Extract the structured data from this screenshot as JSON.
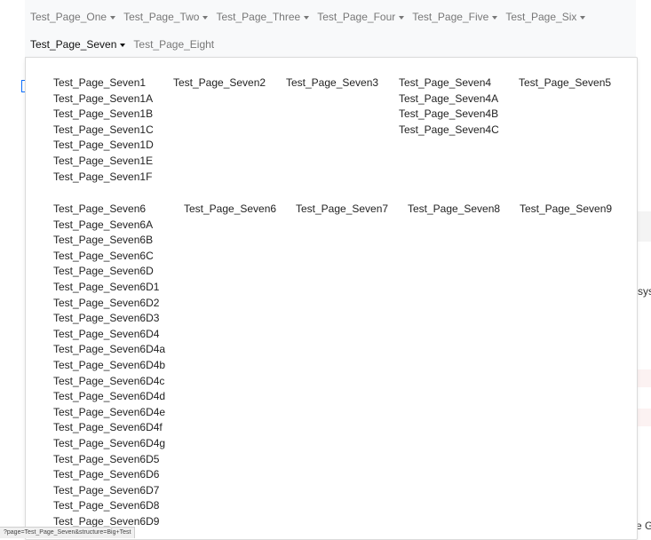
{
  "navbar": {
    "row1": [
      {
        "label": "Test_Page_One"
      },
      {
        "label": "Test_Page_Two"
      },
      {
        "label": "Test_Page_Three"
      },
      {
        "label": "Test_Page_Four"
      },
      {
        "label": "Test_Page_Five"
      },
      {
        "label": "Test_Page_Six"
      }
    ],
    "row2": [
      {
        "label": "Test_Page_Seven",
        "active": true
      },
      {
        "label": "Test_Page_Eight"
      }
    ]
  },
  "dropdown": {
    "group1": {
      "col1": [
        "Test_Page_Seven1",
        "Test_Page_Seven1A",
        "Test_Page_Seven1B",
        "Test_Page_Seven1C",
        "Test_Page_Seven1D",
        "Test_Page_Seven1E",
        "Test_Page_Seven1F"
      ],
      "col2": [
        "Test_Page_Seven2"
      ],
      "col3": [
        "Test_Page_Seven3"
      ],
      "col4": [
        "Test_Page_Seven4",
        "Test_Page_Seven4A",
        "Test_Page_Seven4B",
        "Test_Page_Seven4C"
      ],
      "col5": [
        "Test_Page_Seven5"
      ]
    },
    "group2": {
      "col1": [
        "Test_Page_Seven6",
        "Test_Page_Seven6A",
        "Test_Page_Seven6B",
        "Test_Page_Seven6C",
        "Test_Page_Seven6D",
        "Test_Page_Seven6D1",
        "Test_Page_Seven6D2",
        "Test_Page_Seven6D3",
        "Test_Page_Seven6D4",
        "Test_Page_Seven6D4a",
        "Test_Page_Seven6D4b",
        "Test_Page_Seven6D4c",
        "Test_Page_Seven6D4d",
        "Test_Page_Seven6D4e",
        "Test_Page_Seven6D4f",
        "Test_Page_Seven6D4g",
        "Test_Page_Seven6D5",
        "Test_Page_Seven6D6",
        "Test_Page_Seven6D7",
        "Test_Page_Seven6D8",
        "Test_Page_Seven6D9"
      ],
      "col2": [
        "Test_Page_Seven6"
      ],
      "col3": [
        "Test_Page_Seven7"
      ],
      "col4": [
        "Test_Page_Seven8"
      ],
      "col5": [
        "Test_Page_Seven9"
      ]
    }
  },
  "background": {
    "right_text": "syst",
    "right_text_bottom": "e Ga"
  },
  "status_bar": {
    "url": "?page=Test_Page_Seven&structure=Big+Test"
  },
  "colors": {
    "navbar_bg": "#f8f9fa",
    "accent_blue": "#0d6efd",
    "row_tint": "#fcf2f2"
  }
}
